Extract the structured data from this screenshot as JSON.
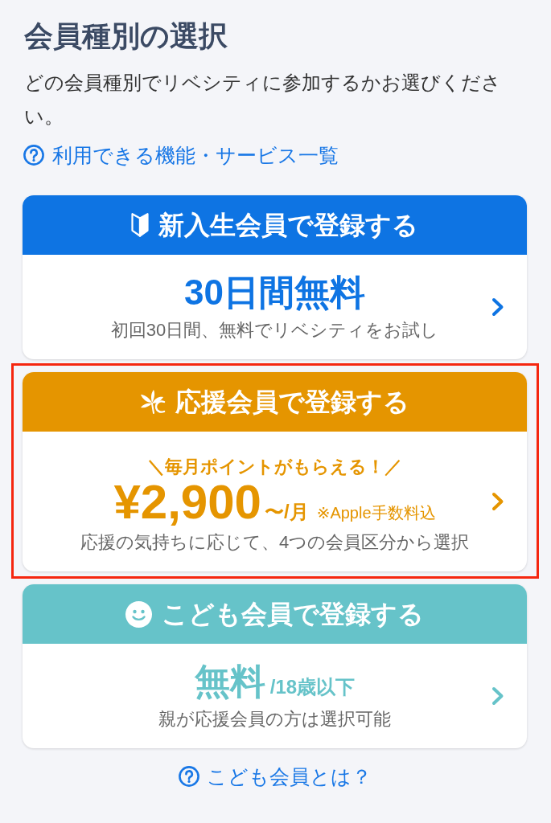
{
  "page": {
    "title": "会員種別の選択",
    "description": "どの会員種別でリベシティに参加するかお選びください。",
    "feature_link": "利用できる機能・サービス一覧"
  },
  "cards": [
    {
      "kind": "beginner",
      "color": "#0e74e3",
      "highlighted": false,
      "title": "新入生会員で登録する",
      "price": "30日間無料",
      "description": "初回30日間、無料でリベシティをお試し"
    },
    {
      "kind": "supporter",
      "color": "#e59500",
      "highlighted": true,
      "title": "応援会員で登録する",
      "tagline": "＼毎月ポイントがもらえる！／",
      "price": "¥2,900",
      "unit": "〜/月",
      "note": "※Apple手数料込",
      "description": "応援の気持ちに応じて、4つの会員区分から選択"
    },
    {
      "kind": "child",
      "color": "#66c3c9",
      "highlighted": false,
      "title": "こども会員で登録する",
      "price": "無料",
      "unit": "/18歳以下",
      "description": "親が応援会員の方は選択可能"
    }
  ],
  "kids_link": "こども会員とは？"
}
